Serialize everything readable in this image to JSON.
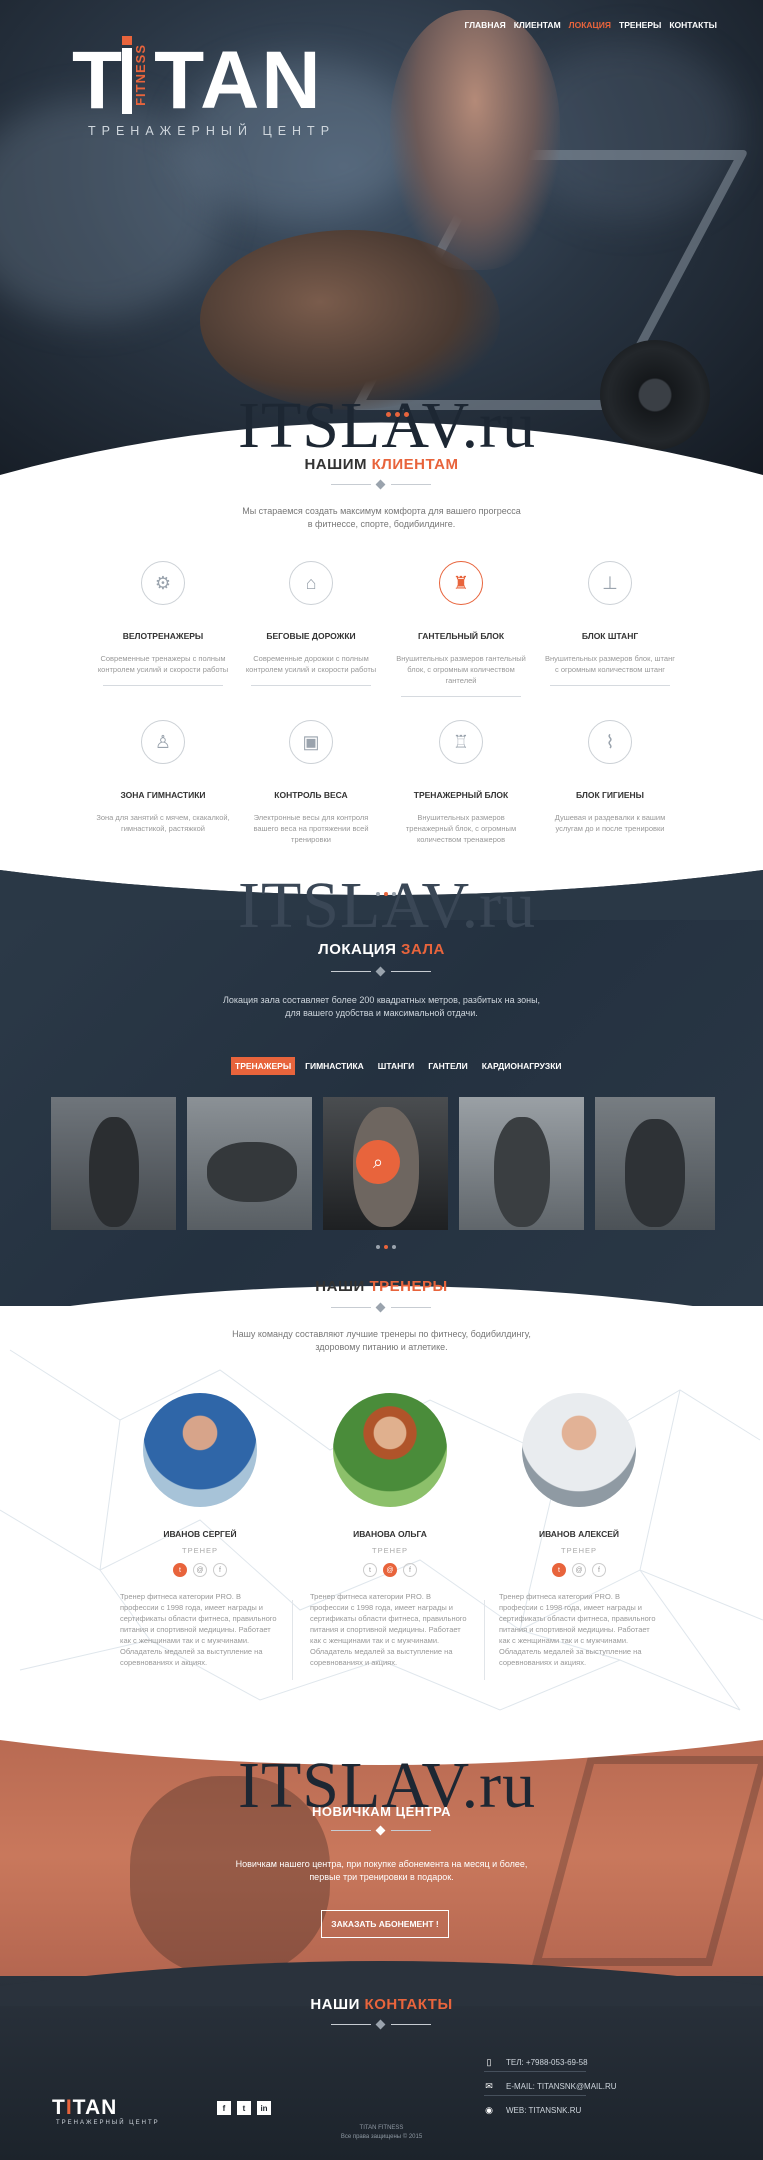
{
  "nav": {
    "items": [
      "ГЛАВНАЯ",
      "КЛИЕНТАМ",
      "ЛОКАЦИЯ",
      "ТРЕНЕРЫ",
      "КОНТАКТЫ"
    ],
    "active": "ЛОКАЦИЯ"
  },
  "hero": {
    "logo_t": "T",
    "logo_i": "I",
    "logo_rest": "TAN",
    "logo_fitness": "FITNESS",
    "subtitle": "ТРЕНАЖЕРНЫЙ ЦЕНТР"
  },
  "watermark": "ITSLAV.ru",
  "clients": {
    "title_a": "НАШИМ",
    "title_b": "КЛИЕНТАМ",
    "desc": "Мы стараемся создать максимум комфорта для вашего прогресса в фитнессе, спорте, бодибилдинге.",
    "services": [
      {
        "name": "ВЕЛОТРЕНАЖЕРЫ",
        "text": "Современные тренажеры с полным контролем усилий и скорости работы",
        "icon": "bike-icon"
      },
      {
        "name": "БЕГОВЫЕ ДОРОЖКИ",
        "text": "Современные дорожки с полным контролем усилий и скорости работы",
        "icon": "treadmill-icon"
      },
      {
        "name": "ГАНТЕЛЬНЫЙ БЛОК",
        "text": "Внушительных размеров гантельный блок, с огромным количеством гантелей",
        "icon": "dumbbell-icon"
      },
      {
        "name": "БЛОК ШТАНГ",
        "text": "Внушительных размеров блок, штанг с огромным количеством штанг",
        "icon": "barbell-icon"
      },
      {
        "name": "ЗОНА ГИМНАСТИКИ",
        "text": "Зона для занятий с мячем, скакалкой, гимнастикой, растяжкой",
        "icon": "gymnastics-icon"
      },
      {
        "name": "КОНТРОЛЬ ВЕСА",
        "text": "Электронные весы для контроля вашего веса на протяжении всей тренировки",
        "icon": "scale-icon"
      },
      {
        "name": "ТРЕНАЖЕРНЫЙ БЛОК",
        "text": "Внушительных размеров тренажерный блок, с огромным количеством тренажеров",
        "icon": "machine-icon"
      },
      {
        "name": "БЛОК ГИГИЕНЫ",
        "text": "Душевая и раздевалки к вашим услугам до и после тренировки",
        "icon": "hygiene-icon"
      }
    ]
  },
  "location": {
    "title_a": "ЛОКАЦИЯ",
    "title_b": "ЗАЛА",
    "desc_1": "Локация зала составляет более 200 квадратных метров, разбитых на зоны,",
    "desc_2": "для вашего удобства и максимальной отдачи.",
    "tabs": [
      "ТРЕНАЖЕРЫ",
      "ГИМНАСТИКА",
      "ШТАНГИ",
      "ГАНТЕЛИ",
      "КАРДИОНАГРУЗКИ"
    ],
    "active_tab": "ТРЕНАЖЕРЫ"
  },
  "trainers": {
    "title_a": "НАШИ",
    "title_b": "ТРЕНЕРЫ",
    "desc_1": "Нашу команду составляют лучшие тренеры по фитнесу, бодибилдингу,",
    "desc_2": "здоровому питанию и атлетике.",
    "role": "ТРЕНЕР",
    "bio": "Тренер фитнеса категории PRO. В профессии с 1998 года, имеет награды и сертификаты области фитнеса, правильного питания и спортивной медицины. Работает как с женщинами так и с мужчинами. Обладатель медалей за выступление на соревнованиях и акциях.",
    "people": [
      {
        "name": "ИВАНОВ СЕРГЕЙ"
      },
      {
        "name": "ИВАНОВА ОЛЬГА"
      },
      {
        "name": "ИВАНОВ АЛЕКСЕЙ"
      }
    ]
  },
  "newcomers": {
    "title_a": "НОВИЧКАМ",
    "title_b": "ЦЕНТРА",
    "desc_1": "Новичкам нашего центра, при покупке абонемента на месяц и более,",
    "desc_2": "первые три тренировки в подарок.",
    "button": "ЗАКАЗАТЬ АБОНЕМЕНТ !"
  },
  "contacts": {
    "title_a": "НАШИ",
    "title_b": "КОНТАКТЫ",
    "phone": "ТЕЛ: +7988-053-69-58",
    "email": "E-MAIL: TITANSNK@MAIL.RU",
    "web": "WEB: TITANSNK.RU",
    "footer_logo": "TITAN",
    "footer_sub": "ТРЕНАЖЕРНЫЙ ЦЕНТР",
    "copy_1": "TITAN FITNESS",
    "copy_2": "Все права защищены © 2015",
    "social": [
      "f",
      "t",
      "in"
    ]
  },
  "colors": {
    "accent": "#e8643c",
    "dark": "#243140"
  }
}
